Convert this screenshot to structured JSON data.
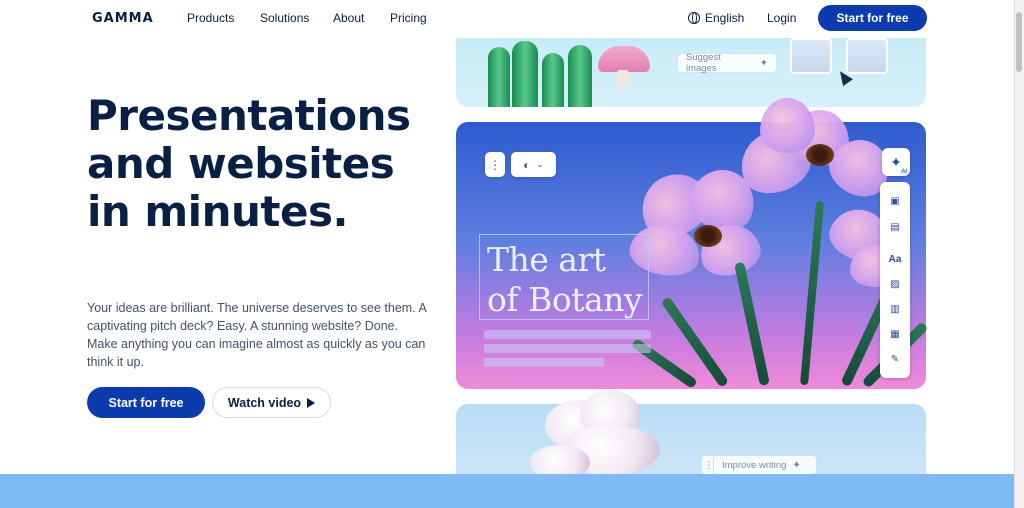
{
  "nav": {
    "logo": "GAMMA",
    "links": [
      "Products",
      "Solutions",
      "About",
      "Pricing"
    ],
    "language": "English",
    "login": "Login",
    "cta": "Start for free"
  },
  "hero": {
    "headline": "Presentations and websites in minutes.",
    "subtext": "Your ideas are brilliant. The universe deserves to see them. A captivating pitch deck? Easy. A stunning website? Done. Make anything you can imagine almost as quickly as you can think it up.",
    "primary_cta": "Start for free",
    "secondary_cta": "Watch video"
  },
  "preview": {
    "suggest_images": "Suggest images",
    "slide_title_line1": "The art",
    "slide_title_line2": "of Botany",
    "improve_writing": "Improve writing",
    "toolbar_text_icon": "Aa",
    "ai_badge": "AI"
  },
  "icons": [
    "globe-icon",
    "play-icon",
    "sparkle-icon",
    "more-vertical-icon",
    "palette-icon",
    "chevron-down-icon",
    "cursor-icon"
  ],
  "colors": {
    "primary": "#0c3bad",
    "text": "#0a1f44",
    "band": "#7fbaf6"
  }
}
